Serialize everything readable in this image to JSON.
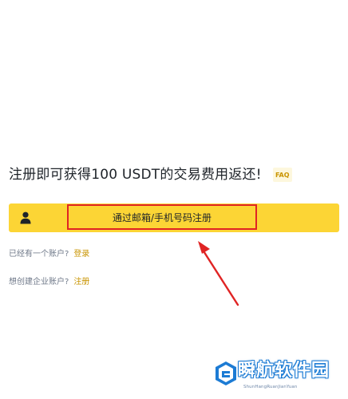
{
  "signup": {
    "headline": "注册即可获得100 USDT的交易费用返还!",
    "faq_label": "FAQ",
    "email_phone_button": "通过邮箱/手机号码注册",
    "user_icon": "user-icon"
  },
  "links": {
    "login_prompt": "已经有一个账户?",
    "login_action": "登录",
    "enterprise_prompt": "想创建企业账户?",
    "enterprise_action": "注册"
  },
  "watermark": {
    "title": "瞬航软件园",
    "subtitle": "ShunHangRuanJianYuan"
  },
  "colors": {
    "brand_yellow": "#fcd535",
    "link_gold": "#c99400",
    "highlight_red": "#e02424",
    "text_primary": "#1e2329",
    "text_muted": "#707a8a"
  }
}
